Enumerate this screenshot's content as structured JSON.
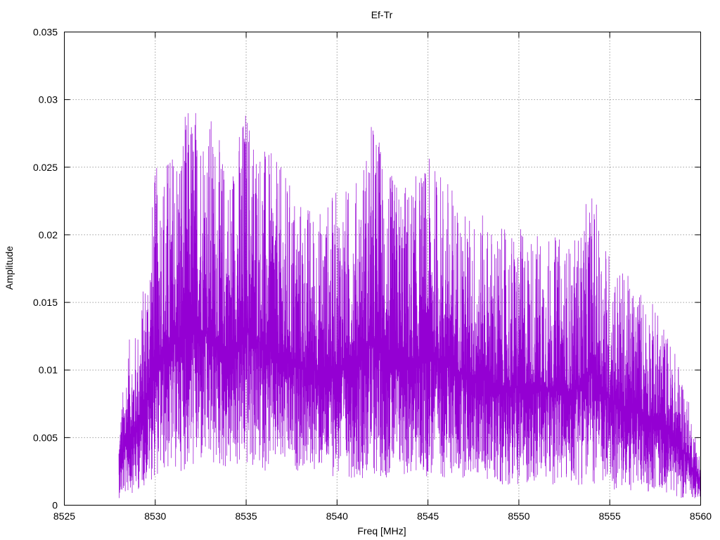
{
  "chart_data": {
    "type": "line",
    "title": "Ef-Tr",
    "xlabel": "Freq [MHz]",
    "ylabel": "Amplitude",
    "xlim": [
      8525,
      8560
    ],
    "ylim": [
      0,
      0.035
    ],
    "x_ticks": [
      "8525",
      "8530",
      "8535",
      "8540",
      "8545",
      "8550",
      "8555",
      "8560"
    ],
    "y_ticks": [
      "0",
      "0.005",
      "0.01",
      "0.015",
      "0.02",
      "0.025",
      "0.03",
      "0.035"
    ],
    "grid": true,
    "legend": "none",
    "series": [
      {
        "color": "#9400d3",
        "x_start": 8528.0,
        "x_end": 8560.0,
        "envelope": [
          {
            "x": 8528.0,
            "y_min": 0.0005,
            "y_max": 0.0058
          },
          {
            "x": 8528.5,
            "y_min": 0.0008,
            "y_max": 0.0122
          },
          {
            "x": 8529.0,
            "y_min": 0.001,
            "y_max": 0.013
          },
          {
            "x": 8529.5,
            "y_min": 0.0015,
            "y_max": 0.018
          },
          {
            "x": 8530.0,
            "y_min": 0.002,
            "y_max": 0.025
          },
          {
            "x": 8531.0,
            "y_min": 0.0025,
            "y_max": 0.027
          },
          {
            "x": 8532.0,
            "y_min": 0.0025,
            "y_max": 0.0303
          },
          {
            "x": 8533.0,
            "y_min": 0.0025,
            "y_max": 0.0295
          },
          {
            "x": 8534.0,
            "y_min": 0.0025,
            "y_max": 0.025
          },
          {
            "x": 8535.0,
            "y_min": 0.0025,
            "y_max": 0.0303
          },
          {
            "x": 8536.0,
            "y_min": 0.0025,
            "y_max": 0.0267
          },
          {
            "x": 8537.0,
            "y_min": 0.0025,
            "y_max": 0.025
          },
          {
            "x": 8538.0,
            "y_min": 0.0025,
            "y_max": 0.023
          },
          {
            "x": 8539.0,
            "y_min": 0.0025,
            "y_max": 0.022
          },
          {
            "x": 8540.0,
            "y_min": 0.002,
            "y_max": 0.0235
          },
          {
            "x": 8541.0,
            "y_min": 0.002,
            "y_max": 0.024
          },
          {
            "x": 8542.0,
            "y_min": 0.002,
            "y_max": 0.029
          },
          {
            "x": 8543.0,
            "y_min": 0.002,
            "y_max": 0.0245
          },
          {
            "x": 8544.0,
            "y_min": 0.002,
            "y_max": 0.024
          },
          {
            "x": 8545.0,
            "y_min": 0.002,
            "y_max": 0.0257
          },
          {
            "x": 8546.0,
            "y_min": 0.002,
            "y_max": 0.0248
          },
          {
            "x": 8547.0,
            "y_min": 0.002,
            "y_max": 0.022
          },
          {
            "x": 8548.0,
            "y_min": 0.002,
            "y_max": 0.0215
          },
          {
            "x": 8549.0,
            "y_min": 0.0015,
            "y_max": 0.0205
          },
          {
            "x": 8550.0,
            "y_min": 0.0015,
            "y_max": 0.0205
          },
          {
            "x": 8551.0,
            "y_min": 0.0015,
            "y_max": 0.0205
          },
          {
            "x": 8552.0,
            "y_min": 0.0015,
            "y_max": 0.02
          },
          {
            "x": 8553.0,
            "y_min": 0.0015,
            "y_max": 0.0195
          },
          {
            "x": 8554.0,
            "y_min": 0.0015,
            "y_max": 0.0235
          },
          {
            "x": 8555.0,
            "y_min": 0.001,
            "y_max": 0.019
          },
          {
            "x": 8556.0,
            "y_min": 0.001,
            "y_max": 0.017
          },
          {
            "x": 8557.0,
            "y_min": 0.001,
            "y_max": 0.016
          },
          {
            "x": 8558.0,
            "y_min": 0.001,
            "y_max": 0.0135
          },
          {
            "x": 8559.0,
            "y_min": 0.0005,
            "y_max": 0.01
          },
          {
            "x": 8560.0,
            "y_min": 0.0005,
            "y_max": 0.0035
          }
        ]
      }
    ]
  }
}
